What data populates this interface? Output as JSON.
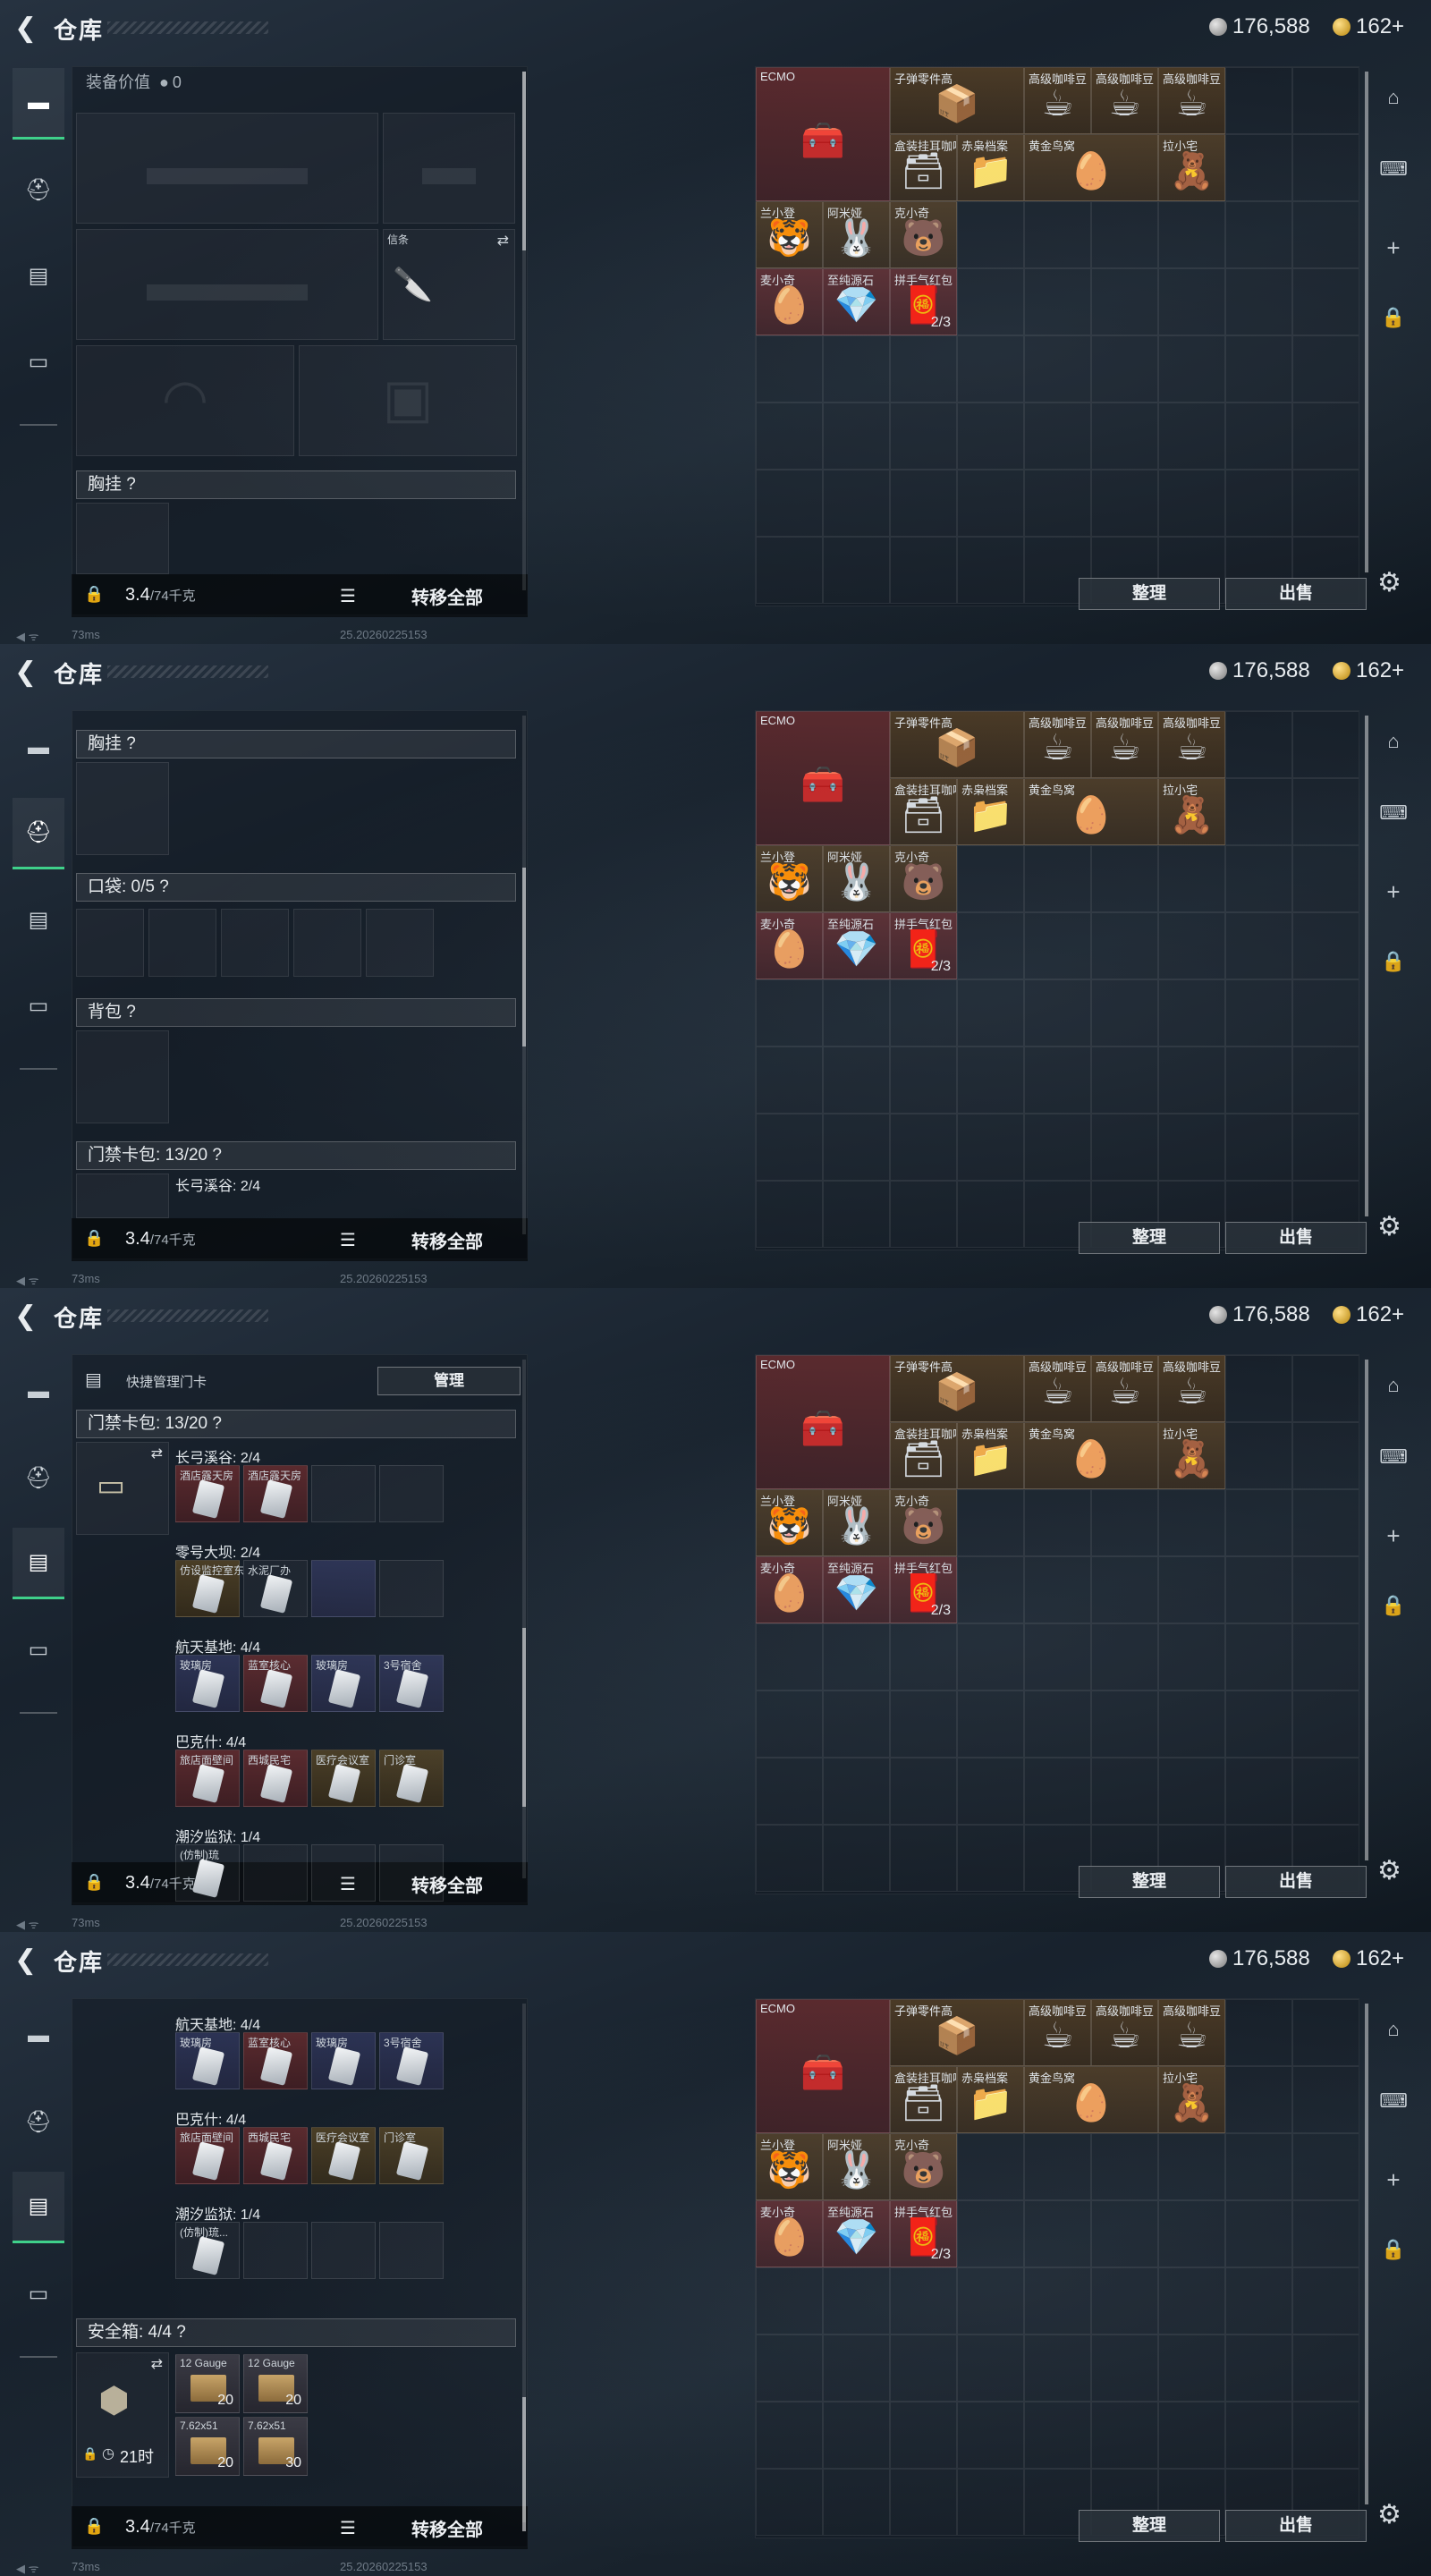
{
  "app": {
    "title": "仓库",
    "currency_silver": "176,588",
    "currency_gold": "162+"
  },
  "colors": {
    "accent": "#3fd08a",
    "rare_red": "#5a2a2e",
    "rare_gold": "#4a3a26",
    "rare_blue": "#2c3354"
  },
  "footer": {
    "weight_value": "3.4",
    "weight_max": "/74千克",
    "transfer_all": "转移全部",
    "ping": "73ms",
    "build": "25.20260225153"
  },
  "stash": {
    "sort_button": "整理",
    "sell_button": "出售",
    "items": {
      "ecmo": "ECMO",
      "bullet_parts": "子弹零件高",
      "coffee1": "高级咖啡豆",
      "coffee2": "高级咖啡豆",
      "coffee3": "高级咖啡豆",
      "boxed": "盒装挂耳咖啡",
      "fox_file": "赤枭档案",
      "golden_nest": "黄金鸟窝",
      "lazy_home": "拉小宅",
      "lan_xiaodeng": "兰小登",
      "amilu": "阿米娅",
      "ke_xiaoqi": "克小奇",
      "mai_xiaoqi": "麦小奇",
      "sapphire": "至纯源石",
      "red_envelope": "拼手气红包",
      "red_envelope_count": "2/3"
    }
  },
  "panel1": {
    "equipment_value_label": "装备价值",
    "equipment_value": "0",
    "knife_label": "信条",
    "chest_rig": "胸挂 ?"
  },
  "panel2": {
    "chest_rig": "胸挂 ?",
    "pockets": "口袋: 0/5 ?",
    "backpack": "背包 ?",
    "keycard_pack": "门禁卡包: 13/20 ?",
    "map_changgong": "长弓溪谷: 2/4"
  },
  "panel3": {
    "quick_manage": "快捷管理门卡",
    "manage_button": "管理",
    "keycard_pack": "门禁卡包: 13/20 ?",
    "maps": [
      {
        "name": "长弓溪谷: 2/4",
        "cards": [
          "酒店露天房",
          "酒店露天房"
        ]
      },
      {
        "name": "零号大坝: 2/4",
        "cards": [
          "仿设监控室东",
          "水泥厂办"
        ]
      },
      {
        "name": "航天基地: 4/4",
        "cards": [
          "玻璃房",
          "蓝室核心",
          "玻璃房",
          "3号宿舍"
        ]
      },
      {
        "name": "巴克什: 4/4",
        "cards": [
          "旅店面壁间",
          "西城民宅",
          "医疗会议室",
          "门诊室"
        ]
      },
      {
        "name": "潮汐监狱: 1/4",
        "cards": [
          "(仿制)琉"
        ]
      }
    ]
  },
  "panel4": {
    "maps": [
      {
        "name": "航天基地: 4/4",
        "cards": [
          "玻璃房",
          "蓝室核心",
          "玻璃房",
          "3号宿舍"
        ]
      },
      {
        "name": "巴克什: 4/4",
        "cards": [
          "旅店面壁间",
          "西城民宅",
          "医疗会议室",
          "门诊室"
        ]
      },
      {
        "name": "潮汐监狱: 1/4",
        "cards": [
          "(仿制)琉..."
        ]
      }
    ],
    "safe_box": "安全箱: 4/4 ?",
    "safe_timer": "21时",
    "ammo": [
      {
        "name": "12 Gauge",
        "count": "20"
      },
      {
        "name": "12 Gauge",
        "count": "20"
      },
      {
        "name": "7.62x51",
        "count": "20"
      },
      {
        "name": "7.62x51",
        "count": "30"
      }
    ]
  }
}
